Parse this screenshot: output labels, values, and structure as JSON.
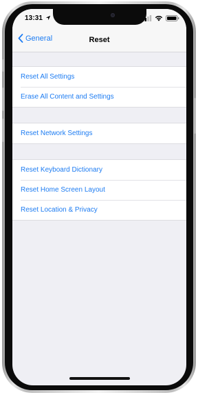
{
  "status_bar": {
    "time": "13:31",
    "icons": [
      "location-arrow-icon",
      "cellular-signal-icon",
      "wifi-icon",
      "battery-icon"
    ]
  },
  "nav": {
    "back_label": "General",
    "title": "Reset"
  },
  "groups": [
    {
      "items": [
        {
          "label": "Reset All Settings"
        },
        {
          "label": "Erase All Content and Settings"
        }
      ]
    },
    {
      "items": [
        {
          "label": "Reset Network Settings"
        }
      ]
    },
    {
      "items": [
        {
          "label": "Reset Keyboard Dictionary"
        },
        {
          "label": "Reset Home Screen Layout"
        },
        {
          "label": "Reset Location & Privacy"
        }
      ]
    }
  ],
  "colors": {
    "accent": "#1d7cf2",
    "background": "#efeff4",
    "bar_background": "#f7f7f7",
    "cell_background": "#ffffff"
  }
}
